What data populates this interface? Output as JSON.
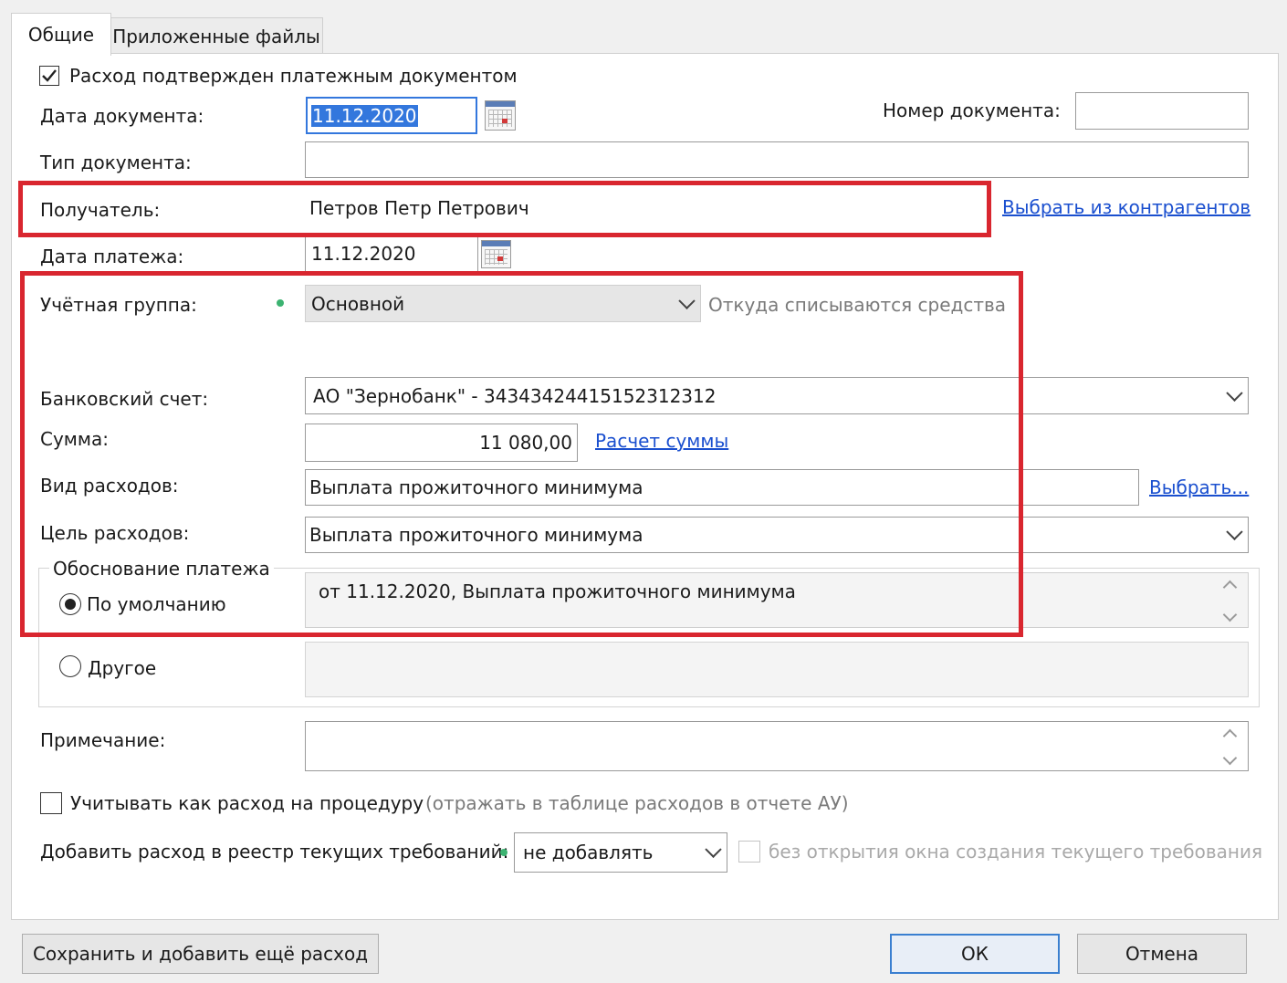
{
  "tabs": [
    {
      "label": "Общие",
      "active": true
    },
    {
      "label": "Приложенные файлы",
      "active": false
    }
  ],
  "form": {
    "confirmed_label": "Расход подтвержден платежным документом",
    "confirmed_checked": true,
    "doc_date_label": "Дата документа:",
    "doc_date_value": "11.12.2020",
    "doc_number_label": "Номер документа:",
    "doc_number_value": "",
    "doc_type_label": "Тип документа:",
    "doc_type_value": "",
    "recipient_label": "Получатель:",
    "recipient_value": "Петров Петр Петрович",
    "recipient_link": "Выбрать из контрагентов",
    "pay_date_label": "Дата платежа:",
    "pay_date_value": "11.12.2020",
    "acc_group_label": "Учётная группа:",
    "acc_group_value": "Основной",
    "acc_group_hint": "Откуда списываются средства",
    "bank_label": "Банковский счет:",
    "bank_value": "АО \"Зернобанк\" - 34343424415152312312",
    "sum_label": "Сумма:",
    "sum_value": "11 080,00",
    "sum_link": "Расчет суммы",
    "exp_kind_label": "Вид расходов:",
    "exp_kind_value": "Выплата прожиточного минимума",
    "exp_kind_link": "Выбрать...",
    "exp_goal_label": "Цель расходов:",
    "exp_goal_value": "Выплата прожиточного минимума",
    "basis_group_label": "Обоснование платежа",
    "basis_default_label": "По умолчанию",
    "basis_default_text": "от 11.12.2020, Выплата прожиточного минимума",
    "basis_other_label": "Другое",
    "basis_other_text": "",
    "note_label": "Примечание:",
    "note_value": "",
    "procedure_label": "Учитывать как расход на процедуру",
    "procedure_hint": "(отражать в таблице расходов в отчете АУ)",
    "procedure_checked": false,
    "registry_label": "Добавить расход в реестр текущих требований:",
    "registry_value": "не добавлять",
    "registry_option_label": "без открытия окна создания текущего требования"
  },
  "buttons": {
    "save_add": "Сохранить и добавить ещё расход",
    "ok": "ОК",
    "cancel": "Отмена"
  },
  "colors": {
    "highlight_red": "#d9262f",
    "link_blue": "#1a4fcf",
    "selection_blue": "#3377dd",
    "required_dot": "#3cb371"
  }
}
